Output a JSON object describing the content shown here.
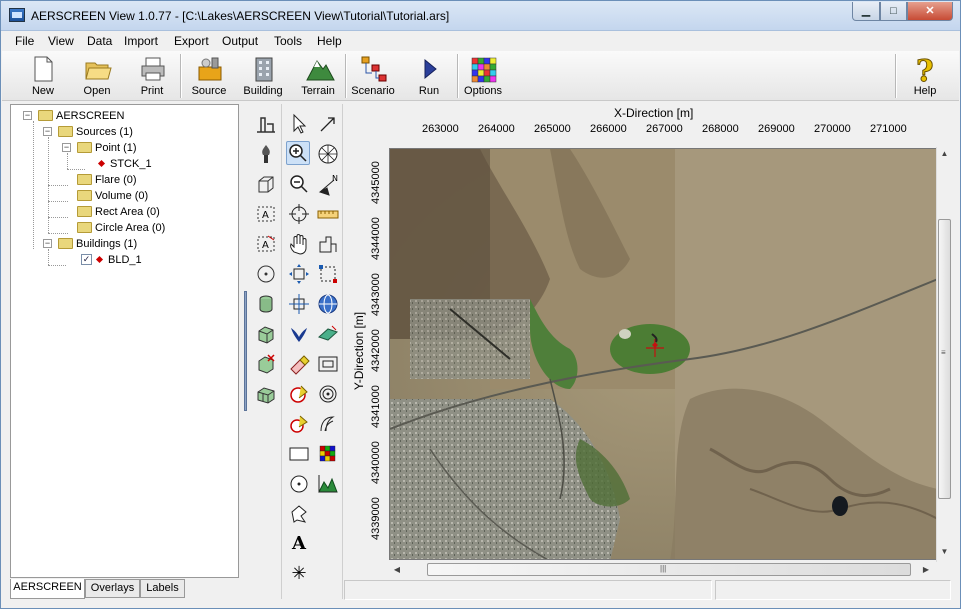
{
  "window": {
    "title": "AERSCREEN View 1.0.77 - [C:\\Lakes\\AERSCREEN View\\Tutorial\\Tutorial.ars]",
    "min_glyph": "▁",
    "max_glyph": "□",
    "close_glyph": "✕"
  },
  "menu": [
    "File",
    "View",
    "Data",
    "Import",
    "Export",
    "Output",
    "Tools",
    "Help"
  ],
  "toolbar": {
    "new": "New",
    "open": "Open",
    "print": "Print",
    "source": "Source",
    "building": "Building",
    "terrain": "Terrain",
    "scenario": "Scenario",
    "run": "Run",
    "options": "Options",
    "help": "Help"
  },
  "tree": {
    "root": "AERSCREEN",
    "sources": "Sources (1)",
    "point": "Point (1)",
    "stck": "STCK_1",
    "flare": "Flare (0)",
    "volume": "Volume (0)",
    "rect": "Rect Area (0)",
    "circle": "Circle Area (0)",
    "buildings": "Buildings (1)",
    "bld": "BLD_1",
    "expand_minus": "−",
    "check": "✓"
  },
  "tabs": {
    "aerscreen": "AERSCREEN",
    "overlays": "Overlays",
    "labels": "Labels"
  },
  "map": {
    "x_axis_label": "X-Direction [m]",
    "y_axis_label": "Y-Direction [m]",
    "x_ticks": [
      "263000",
      "264000",
      "265000",
      "266000",
      "267000",
      "268000",
      "269000",
      "270000",
      "271000"
    ],
    "y_ticks": [
      "4345000",
      "4344000",
      "4343000",
      "4342000",
      "4341000",
      "4340000",
      "4339000"
    ]
  },
  "icons": {
    "arrow_cursor": "pointer-icon",
    "zoom_in": "zoom-in-icon",
    "text_a": "A",
    "asterisk": "✳"
  },
  "scroll": {
    "up": "▲",
    "down": "▼",
    "left": "◀",
    "right": "▶",
    "grip_h": "|||",
    "grip_v": "≡"
  }
}
